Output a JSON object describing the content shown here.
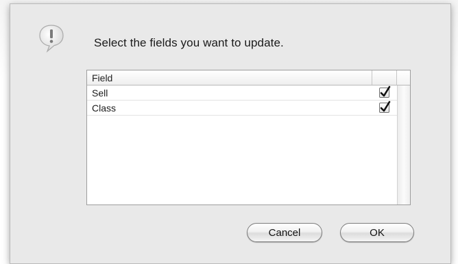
{
  "dialog": {
    "message": "Select the fields you want to update.",
    "icon": "alert-exclamation-icon"
  },
  "table": {
    "columns": [
      "Field",
      ""
    ],
    "rows": [
      {
        "label": "Sell",
        "checked": true
      },
      {
        "label": "Class",
        "checked": true
      }
    ]
  },
  "buttons": {
    "cancel_label": "Cancel",
    "ok_label": "OK"
  },
  "colors": {
    "dialog_bg": "#e9e9e9",
    "table_bg": "#ffffff",
    "border": "#9d9d9d"
  }
}
